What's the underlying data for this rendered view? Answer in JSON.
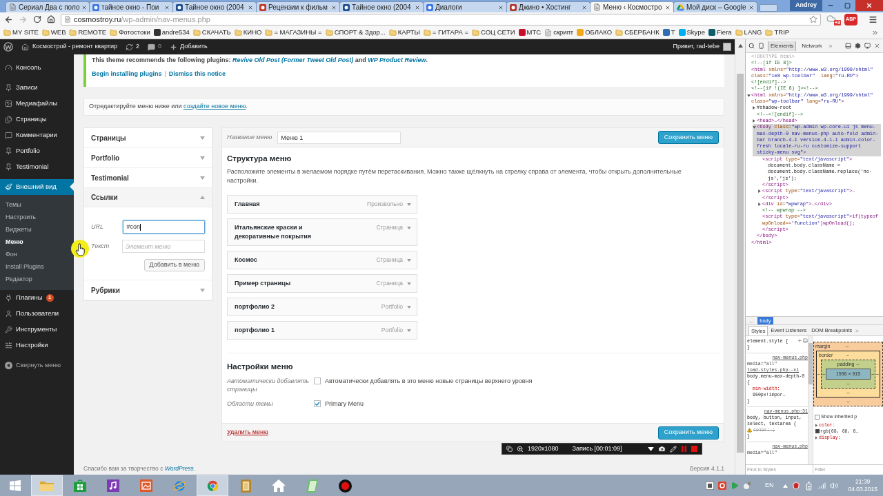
{
  "browser": {
    "tabs": [
      {
        "title": "Сериал Два с поло",
        "selected": false
      },
      {
        "title": "тайное окно - Пои",
        "selected": false
      },
      {
        "title": "Тайное окно (2004",
        "selected": false
      },
      {
        "title": "Рецензии к фильм",
        "selected": false
      },
      {
        "title": "Тайное окно (2004",
        "selected": false
      },
      {
        "title": "Диалоги",
        "selected": false
      },
      {
        "title": "Джино • Хостинг",
        "selected": false
      },
      {
        "title": "Меню ‹ Космостро",
        "selected": true
      },
      {
        "title": "Мой диск – Google",
        "selected": false
      }
    ],
    "profile": "Andrey",
    "address": {
      "host": "cosmostroy.ru",
      "path": "/wp-admin/nav-menus.php"
    },
    "extension_badge": "+3",
    "adblock_label": "ABP",
    "bookmarks": [
      {
        "label": "MY SITE",
        "kind": "folder"
      },
      {
        "label": "WEB",
        "kind": "folder"
      },
      {
        "label": "REMOTE",
        "kind": "folder"
      },
      {
        "label": "Фотостоки",
        "kind": "folder"
      },
      {
        "label": "andre534",
        "kind": "site",
        "color": "#333333"
      },
      {
        "label": "СКАЧАТЬ",
        "kind": "folder"
      },
      {
        "label": "КИНО",
        "kind": "folder"
      },
      {
        "label": "= МАГАЗИНЫ =",
        "kind": "folder"
      },
      {
        "label": "СПОРТ & Здор...",
        "kind": "folder"
      },
      {
        "label": "КАРТЫ",
        "kind": "folder"
      },
      {
        "label": "= ГИТАРА =",
        "kind": "folder"
      },
      {
        "label": "СОЦ СЕТИ",
        "kind": "folder"
      },
      {
        "label": "МТС",
        "kind": "site",
        "color": "#c8102e"
      },
      {
        "label": "скрипт",
        "kind": "page"
      },
      {
        "label": "ОБЛАКО",
        "kind": "site",
        "color": "#f2a81d"
      },
      {
        "label": "СБЕРБАНК",
        "kind": "folder"
      },
      {
        "label": "T",
        "kind": "site",
        "color": "#2d6db5"
      },
      {
        "label": "Skype",
        "kind": "site",
        "color": "#00aff0"
      },
      {
        "label": "Fiera",
        "kind": "site",
        "color": "#0e5f6b"
      },
      {
        "label": "LANG",
        "kind": "folder"
      },
      {
        "label": "TRIP",
        "kind": "folder"
      }
    ]
  },
  "admin_bar": {
    "site": "Космострой - ремонт квартир",
    "updates": "2",
    "comments": "0",
    "new": "Добавить",
    "greeting": "Привет, rad-tebe"
  },
  "sidebar": {
    "groups": [
      {
        "items": [
          {
            "label": "Консоль",
            "selected": false
          }
        ]
      },
      {
        "items": [
          {
            "label": "Записи",
            "selected": false
          },
          {
            "label": "Медиафайлы",
            "selected": false
          },
          {
            "label": "Страницы",
            "selected": false
          },
          {
            "label": "Комментарии",
            "selected": false
          },
          {
            "label": "Portfolio",
            "selected": false
          },
          {
            "label": "Testimonial",
            "selected": false
          }
        ]
      },
      {
        "items": [
          {
            "label": "Внешний вид",
            "selected": true,
            "children": [
              {
                "label": "Темы",
                "selected": false
              },
              {
                "label": "Настроить",
                "selected": false
              },
              {
                "label": "Виджеты",
                "selected": false
              },
              {
                "label": "Меню",
                "selected": true
              },
              {
                "label": "Фон",
                "selected": false
              },
              {
                "label": "Install Plugins",
                "selected": false
              },
              {
                "label": "Редактор",
                "selected": false
              }
            ]
          },
          {
            "label": "Плагины",
            "badge": "1",
            "selected": false
          },
          {
            "label": "Пользователи",
            "selected": false
          },
          {
            "label": "Инструменты",
            "selected": false
          },
          {
            "label": "Настройки",
            "selected": false
          }
        ]
      }
    ],
    "collapse": "Свернуть меню"
  },
  "notice": {
    "segments": [
      {
        "kind": "text",
        "text": "This theme recommends the following plugins: "
      },
      {
        "kind": "link",
        "text": "Revive Old Post (Former Tweet Old Post)"
      },
      {
        "kind": "text",
        "text": " and "
      },
      {
        "kind": "link",
        "text": "WP Product Review"
      },
      {
        "kind": "text",
        "text": "."
      }
    ],
    "actions": [
      "Begin installing plugins",
      "Dismiss this notice"
    ],
    "separator": "|"
  },
  "edit_hint": {
    "segments": [
      {
        "kind": "text",
        "text": "Отредактируйте меню ниже или "
      },
      {
        "kind": "link",
        "text": "создайте новое меню"
      },
      {
        "kind": "text",
        "text": "."
      }
    ]
  },
  "add_items": {
    "sections": [
      {
        "title": "Страницы",
        "expanded": false
      },
      {
        "title": "Portfolio",
        "expanded": false
      },
      {
        "title": "Testimonial",
        "expanded": false
      },
      {
        "title": "Ссылки",
        "expanded": true,
        "fields": [
          {
            "label": "URL",
            "value": "#con",
            "focused": true
          },
          {
            "label": "Текст",
            "placeholder": "Элемент меню",
            "focused": false
          }
        ],
        "button": "Добавить в меню"
      },
      {
        "title": "Рубрики",
        "expanded": false
      }
    ]
  },
  "menu_editor": {
    "name_label": "Название меню",
    "name_value": "Меню 1",
    "save": "Сохранить меню",
    "structure_title": "Структура меню",
    "structure_hint": "Расположите элементы в желаемом порядке путём перетаскивания. Можно также щёлкнуть на стрелку справа от элемента, чтобы открыть дополнительные настройки.",
    "items": [
      {
        "title": "Главная",
        "type": "Произвольно"
      },
      {
        "title": "Итальянские краски и декоративные покрытия",
        "type": "Страница"
      },
      {
        "title": "Космос",
        "type": "Страница"
      },
      {
        "title": "Пример страницы",
        "type": "Страница"
      },
      {
        "title": "портфолио 2",
        "type": "Portfolio"
      },
      {
        "title": "портфолио 1",
        "type": "Portfolio"
      }
    ],
    "settings_title": "Настройки меню",
    "settings": [
      {
        "label": "Автоматически добавлять страницы",
        "option": "Автоматически добавлять в это меню новые страницы верхнего уровня",
        "checked": false
      },
      {
        "label": "Области темы",
        "option": "Primary Menu",
        "checked": true
      }
    ],
    "delete": "Удалить меню",
    "save_bottom": "Сохранить меню"
  },
  "footer": {
    "segments": [
      {
        "kind": "text",
        "text": "Спасибо вам за творчество с "
      },
      {
        "kind": "link",
        "text": "WordPress"
      },
      {
        "kind": "text",
        "text": "."
      }
    ],
    "version": "Версия 4.1.1"
  },
  "devtools": {
    "tabs": [
      {
        "label": "Elements",
        "selected": true
      },
      {
        "label": "Network",
        "selected": false
      }
    ],
    "dom": [
      {
        "text": "<!DOCTYPE html>",
        "kind": "doctype",
        "selected": false
      },
      {
        "text": "<!--[if IE 8]>",
        "kind": "comment",
        "selected": false
      },
      {
        "text": "<html xmlns=\"http://www.w3.org/1999/xhtml\" class=\"ie8 wp-toolbar\"  lang=\"ru-RU\">",
        "kind": "tag",
        "selected": false
      },
      {
        "text": "<![endif]-->",
        "kind": "comment",
        "selected": false
      },
      {
        "text": "<!--[if !(IE 8) ]><!-->",
        "kind": "comment",
        "selected": false
      },
      {
        "text": "<html xmlns=\"http://www.w3.org/1999/xhtml\" class=\"wp-toolbar\" lang=\"ru-RU\">",
        "kind": "tag",
        "expanded": true,
        "selected": false,
        "close": "</html>",
        "children": [
          {
            "text": "#shadow-root",
            "kind": "text",
            "expanded": false,
            "selected": false
          },
          {
            "text": "<!--<![endif]-->",
            "kind": "comment",
            "selected": false
          },
          {
            "text": "<head>…</head>",
            "kind": "tag",
            "expanded": false,
            "selected": false
          },
          {
            "text": "<body class=\"wp-admin wp-core-ui js menu-max-depth-0 nav-menus-php auto-fold admin-bar branch-4-1 version-4-1-1 admin-color-fresh locale-ru-ru customize-support sticky-menu svg\">",
            "kind": "tag",
            "expanded": true,
            "selected": true,
            "close": "</body>",
            "children": [
              {
                "text": "<script type=\"text/javascript\">",
                "kind": "tag",
                "selected": false,
                "close": "</script>",
                "children": [
                  {
                    "text": "document.body.className = document.body.className.replace('no-js','js');",
                    "kind": "text",
                    "selected": false
                  }
                ]
              },
              {
                "text": "<script type=\"text/javascript\">…</script>",
                "kind": "tag",
                "expanded": false,
                "selected": false
              },
              {
                "text": "<div id=\"wpwrap\">…</div>",
                "kind": "tag",
                "expanded": false,
                "selected": false
              },
              {
                "text": "<!-- wpwrap -->",
                "kind": "comment",
                "selected": false
              },
              {
                "text": "<script type=\"text/javascript\">if(typeof wpOnload=='function')wpOnload();</script>",
                "kind": "tag",
                "selected": false
              }
            ]
          }
        ]
      }
    ],
    "breadcrumbs": [
      {
        "label": "...",
        "selected": false
      },
      {
        "label": "body",
        "selected": true
      }
    ],
    "pane_tabs": [
      {
        "label": "Styles",
        "selected": true
      },
      {
        "label": "Event Listeners",
        "selected": false
      },
      {
        "label": "DOM Breakpoints",
        "selected": false
      }
    ],
    "styles": [
      {
        "kind": "selector",
        "text": "element.style {"
      },
      {
        "kind": "brace",
        "text": "}"
      },
      {
        "kind": "source",
        "text": "nav-menus.php"
      },
      {
        "kind": "media",
        "text": "media=\"all\""
      },
      {
        "kind": "link",
        "text": "load-styles.php…-vi"
      },
      {
        "kind": "selector",
        "text": "body.menu-max-depth-0 {"
      },
      {
        "kind": "property",
        "name": "min-width:",
        "value": "950px!impor…"
      },
      {
        "kind": "brace",
        "text": "}"
      },
      {
        "kind": "source",
        "text": "nav-menus.php:31"
      },
      {
        "kind": "selector",
        "text": "body, button, input, select, textarea {"
      },
      {
        "kind": "invalid",
        "name": "color:",
        "value": ";"
      },
      {
        "kind": "brace",
        "text": "}"
      },
      {
        "kind": "source",
        "text": "nav-menus.php"
      },
      {
        "kind": "media",
        "text": "media=\"all\""
      }
    ],
    "box_model": {
      "margin": {
        "label": "margin",
        "top": "–",
        "bottom": "–"
      },
      "border": {
        "label": "border",
        "top": "–",
        "left": "–",
        "right": "–",
        "bottom": "–"
      },
      "padding": {
        "label": "padding",
        "top": "–",
        "left": "–",
        "right": "–",
        "bottom": "–"
      },
      "content": "1596 × 915"
    },
    "show_inherited": {
      "label": "Show inherited p",
      "checked": false
    },
    "computed": [
      {
        "name": "color:",
        "value": "rgb(68, 68, 6…",
        "color": "#444444",
        "expanded": false
      },
      {
        "name": "display:",
        "expanded": false
      }
    ],
    "find_placeholder": "Find in Styles",
    "filter_placeholder": "Filter"
  },
  "recorder": {
    "resolution": "1920x1080",
    "status": "Запись [00:01:09]"
  },
  "taskbar": {
    "apps": [
      {
        "active": true
      },
      {
        "active": false
      },
      {
        "active": false
      },
      {
        "active": false
      },
      {
        "active": false
      },
      {
        "active": true
      },
      {
        "active": false
      },
      {
        "active": false
      },
      {
        "active": false
      },
      {
        "active": false
      }
    ],
    "language": "EN",
    "time": "21:39",
    "date": "04.03.2015"
  }
}
